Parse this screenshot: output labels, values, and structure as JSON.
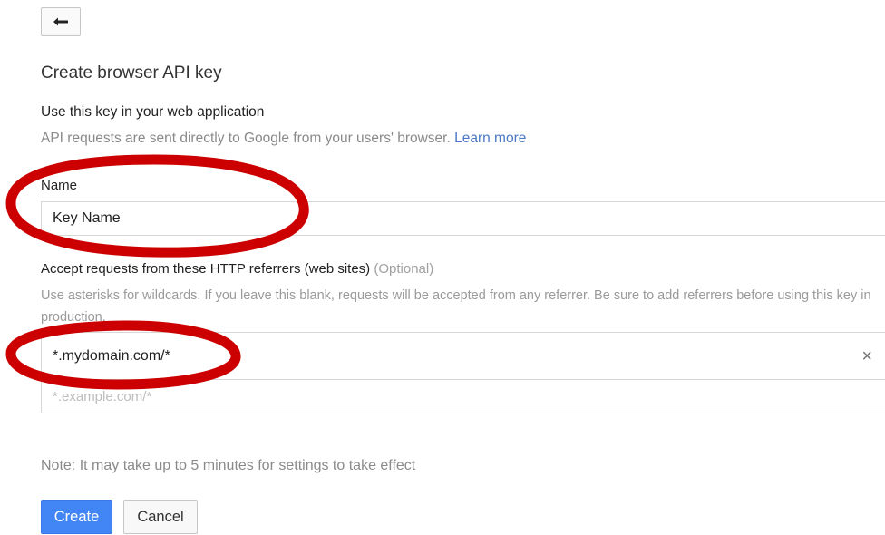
{
  "toolbar": {
    "back_icon": "arrow-back-icon"
  },
  "page": {
    "title": "Create browser API key"
  },
  "intro": {
    "heading": "Use this key in your web application",
    "description": "API requests are sent directly to Google from your users' browser.",
    "learn_more": "Learn more"
  },
  "name_field": {
    "label": "Name",
    "value": "Key Name"
  },
  "referrers": {
    "label": "Accept requests from these HTTP referrers (web sites)",
    "optional": "(Optional)",
    "help": "Use asterisks for wildcards. If you leave this blank, requests will be accepted from any referrer. Be sure to add referrers before using this key in production.",
    "items": [
      "*.mydomain.com/*"
    ],
    "remove_glyph": "×",
    "new_placeholder": "*.example.com/*"
  },
  "note": "Note: It may take up to 5 minutes for settings to take effect",
  "buttons": {
    "create": "Create",
    "cancel": "Cancel"
  },
  "colors": {
    "primary": "#4285f4",
    "link": "#4a78c8",
    "annotation": "#cc0000"
  }
}
